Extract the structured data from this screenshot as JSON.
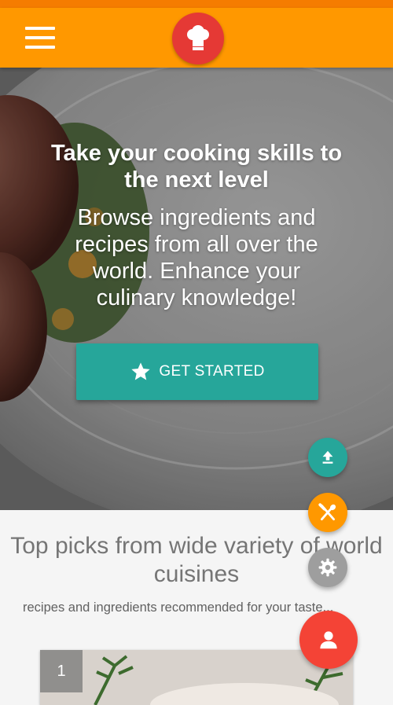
{
  "app": {
    "menu_icon": "hamburger-menu-icon",
    "logo_icon": "chef-hat-icon",
    "colors": {
      "app_bar": "#ff9800",
      "status_bar": "#f57c00",
      "logo": "#e53935",
      "accent": "#26a69a",
      "fab_main": "#f44336"
    }
  },
  "hero": {
    "title": "Take your cooking skills to the next level",
    "subtitle": "Browse ingredients and recipes from all over the world. Enhance your culinary knowledge!",
    "cta_label": "GET STARTED",
    "cta_icon": "star-icon"
  },
  "section": {
    "title": "Top picks from wide variety of world cuisines",
    "subtitle": "recipes and ingredients recommended for your taste...",
    "cards": [
      {
        "index": "1"
      }
    ]
  },
  "fabs": {
    "upload_icon": "upload-icon",
    "food_icon": "fork-knife-icon",
    "settings_icon": "gear-icon",
    "profile_icon": "person-icon"
  }
}
